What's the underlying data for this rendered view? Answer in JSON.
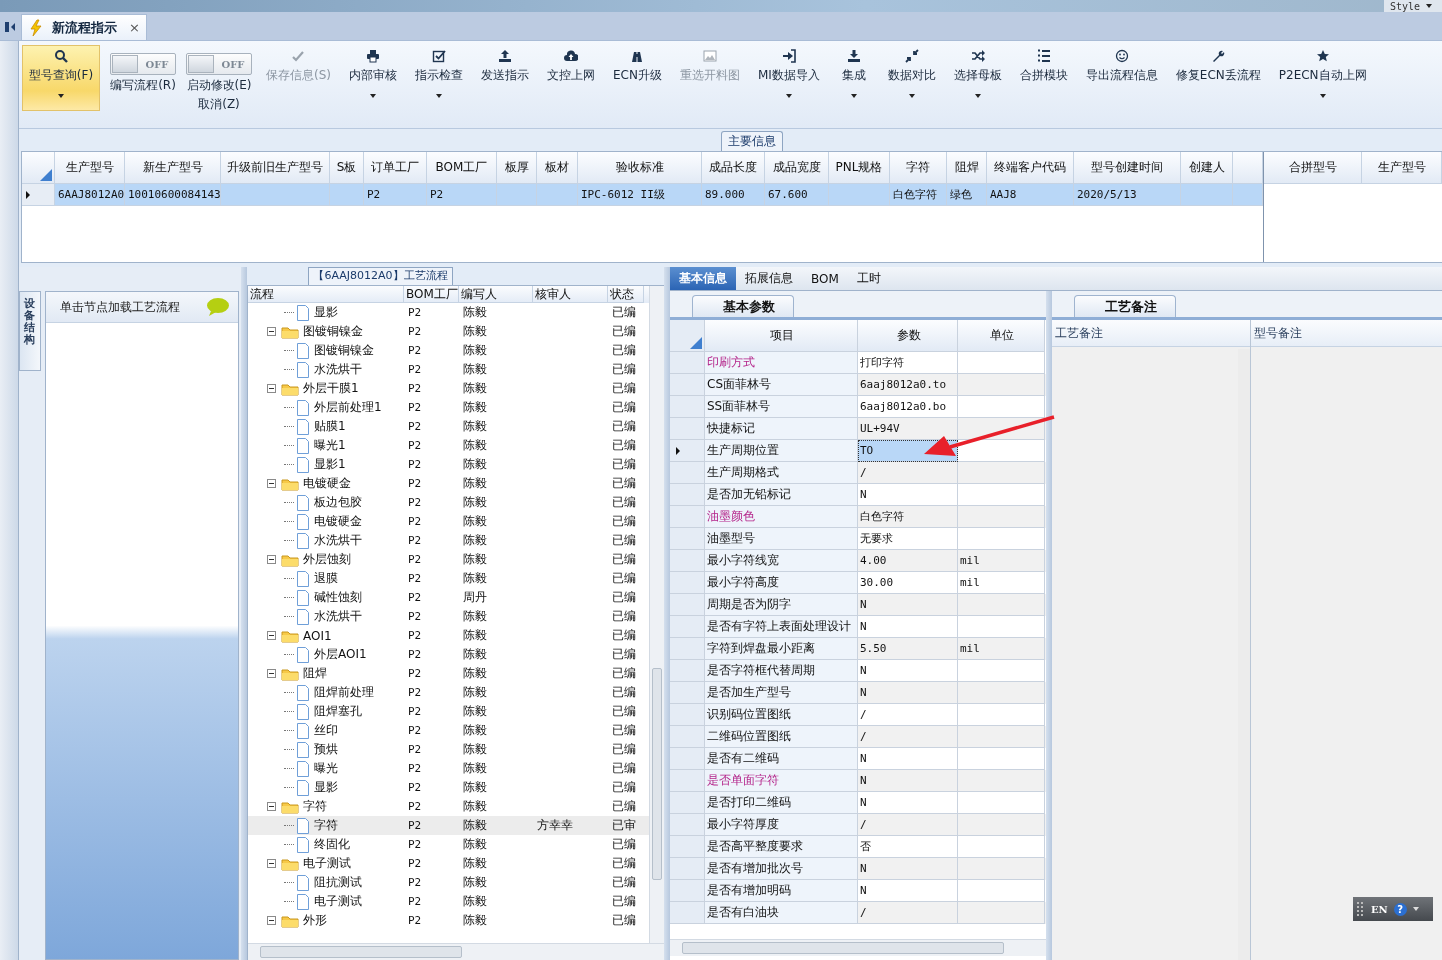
{
  "window": {
    "style_menu": "Style"
  },
  "doc_tab": {
    "title": "新流程指示",
    "close": "×"
  },
  "ribbon": [
    {
      "kind": "button",
      "label": "型号查询(F)",
      "dropdown": true,
      "selected": true,
      "disabled": false
    },
    {
      "kind": "toggle",
      "label": "编写流程(R)",
      "state_text": "OFF",
      "on": false
    },
    {
      "kind": "toggle",
      "label": "启动修改(E)",
      "sublabel": "取消(Z)",
      "state_text": "OFF",
      "on": false
    },
    {
      "kind": "button",
      "label": "保存信息(S)",
      "dropdown": false,
      "selected": false,
      "disabled": true
    },
    {
      "kind": "button",
      "label": "内部审核",
      "dropdown": true,
      "selected": false,
      "disabled": false
    },
    {
      "kind": "button",
      "label": "指示检查",
      "dropdown": true,
      "selected": false,
      "disabled": false
    },
    {
      "kind": "button",
      "label": "发送指示",
      "dropdown": false,
      "selected": false,
      "disabled": false
    },
    {
      "kind": "button",
      "label": "文控上网",
      "dropdown": false,
      "selected": false,
      "disabled": false
    },
    {
      "kind": "button",
      "label": "ECN升级",
      "dropdown": false,
      "selected": false,
      "disabled": false
    },
    {
      "kind": "button",
      "label": "重选开料图",
      "dropdown": false,
      "selected": false,
      "disabled": true
    },
    {
      "kind": "button",
      "label": "MI数据导入",
      "dropdown": true,
      "selected": false,
      "disabled": false
    },
    {
      "kind": "button",
      "label": "集成",
      "dropdown": true,
      "selected": false,
      "disabled": false
    },
    {
      "kind": "button",
      "label": "数据对比",
      "dropdown": true,
      "selected": false,
      "disabled": false
    },
    {
      "kind": "button",
      "label": "选择母板",
      "dropdown": true,
      "selected": false,
      "disabled": false
    },
    {
      "kind": "button",
      "label": "合拼模块",
      "dropdown": false,
      "selected": false,
      "disabled": false
    },
    {
      "kind": "button",
      "label": "导出流程信息",
      "dropdown": false,
      "selected": false,
      "disabled": false
    },
    {
      "kind": "button",
      "label": "修复ECN丢流程",
      "dropdown": false,
      "selected": false,
      "disabled": false
    },
    {
      "kind": "button",
      "label": "P2ECN自动上网",
      "dropdown": true,
      "selected": false,
      "disabled": false
    }
  ],
  "main_info": {
    "title": "主要信息",
    "columns": [
      "生产型号",
      "新生产型号",
      "升级前旧生产型号",
      "S板",
      "订单工厂",
      "BOM工厂",
      "板厚",
      "板材",
      "验收标准",
      "成品长度",
      "成品宽度",
      "PNL规格",
      "字符",
      "阻焊",
      "终端客户代码",
      "型号创建时间",
      "创建人"
    ],
    "rows": [
      {
        "selected": true,
        "cells": [
          "6AAJ8012A0",
          "10010600084143",
          null,
          null,
          "P2",
          "P2",
          null,
          null,
          "IPC-6012 II级",
          "89.000",
          "67.600",
          null,
          "白色字符",
          "绿色",
          "AAJ8",
          "2020/5/13",
          null
        ]
      }
    ]
  },
  "merge_grid": {
    "columns": [
      "合拼型号",
      "生产型号"
    ]
  },
  "side_tab": "设备结构",
  "side_hint": "单击节点加载工艺流程",
  "flow": {
    "title": "【6AAJ8012A0】工艺流程",
    "columns": [
      "流程",
      "BOM工厂",
      "编写人",
      "核审人",
      "状态"
    ],
    "nodes": [
      {
        "kind": "folder",
        "expanded": true,
        "children": [
          {
            "kind": "file",
            "name": "显影",
            "bom": "P2",
            "author": "陈毅",
            "status": "已编",
            "selected": false
          }
        ]
      },
      {
        "kind": "folder",
        "name": "图镀铜镍金",
        "bom": "P2",
        "author": "陈毅",
        "status": "已编",
        "selected": false,
        "expanded": true,
        "children": [
          {
            "kind": "file",
            "name": "图镀铜镍金",
            "bom": "P2",
            "author": "陈毅",
            "status": "已编",
            "selected": false
          },
          {
            "kind": "file",
            "name": "水洗烘干",
            "bom": "P2",
            "author": "陈毅",
            "status": "已编",
            "selected": false
          }
        ]
      },
      {
        "kind": "folder",
        "name": "外层干膜1",
        "bom": "P2",
        "author": "陈毅",
        "status": "已编",
        "selected": false,
        "expanded": true,
        "children": [
          {
            "kind": "file",
            "name": "外层前处理1",
            "bom": "P2",
            "author": "陈毅",
            "status": "已编",
            "selected": false
          },
          {
            "kind": "file",
            "name": "贴膜1",
            "bom": "P2",
            "author": "陈毅",
            "status": "已编",
            "selected": false
          },
          {
            "kind": "file",
            "name": "曝光1",
            "bom": "P2",
            "author": "陈毅",
            "status": "已编",
            "selected": false
          },
          {
            "kind": "file",
            "name": "显影1",
            "bom": "P2",
            "author": "陈毅",
            "status": "已编",
            "selected": false
          }
        ]
      },
      {
        "kind": "folder",
        "name": "电镀硬金",
        "bom": "P2",
        "author": "陈毅",
        "status": "已编",
        "selected": false,
        "expanded": true,
        "children": [
          {
            "kind": "file",
            "name": "板边包胶",
            "bom": "P2",
            "author": "陈毅",
            "status": "已编",
            "selected": false
          },
          {
            "kind": "file",
            "name": "电镀硬金",
            "bom": "P2",
            "author": "陈毅",
            "status": "已编",
            "selected": false
          },
          {
            "kind": "file",
            "name": "水洗烘干",
            "bom": "P2",
            "author": "陈毅",
            "status": "已编",
            "selected": false
          }
        ]
      },
      {
        "kind": "folder",
        "name": "外层蚀刻",
        "bom": "P2",
        "author": "陈毅",
        "status": "已编",
        "selected": false,
        "expanded": true,
        "children": [
          {
            "kind": "file",
            "name": "退膜",
            "bom": "P2",
            "author": "陈毅",
            "status": "已编",
            "selected": false
          },
          {
            "kind": "file",
            "name": "碱性蚀刻",
            "bom": "P2",
            "author": "周丹",
            "status": "已编",
            "selected": false
          },
          {
            "kind": "file",
            "name": "水洗烘干",
            "bom": "P2",
            "author": "陈毅",
            "status": "已编",
            "selected": false
          }
        ]
      },
      {
        "kind": "folder",
        "name": "AOI1",
        "bom": "P2",
        "author": "陈毅",
        "status": "已编",
        "selected": false,
        "expanded": true,
        "children": [
          {
            "kind": "file",
            "name": "外层AOI1",
            "bom": "P2",
            "author": "陈毅",
            "status": "已编",
            "selected": false
          }
        ]
      },
      {
        "kind": "folder",
        "name": "阻焊",
        "bom": "P2",
        "author": "陈毅",
        "status": "已编",
        "selected": false,
        "expanded": true,
        "children": [
          {
            "kind": "file",
            "name": "阻焊前处理",
            "bom": "P2",
            "author": "陈毅",
            "status": "已编",
            "selected": false
          },
          {
            "kind": "file",
            "name": "阻焊塞孔",
            "bom": "P2",
            "author": "陈毅",
            "status": "已编",
            "selected": false
          },
          {
            "kind": "file",
            "name": "丝印",
            "bom": "P2",
            "author": "陈毅",
            "status": "已编",
            "selected": false
          },
          {
            "kind": "file",
            "name": "预烘",
            "bom": "P2",
            "author": "陈毅",
            "status": "已编",
            "selected": false
          },
          {
            "kind": "file",
            "name": "曝光",
            "bom": "P2",
            "author": "陈毅",
            "status": "已编",
            "selected": false
          },
          {
            "kind": "file",
            "name": "显影",
            "bom": "P2",
            "author": "陈毅",
            "status": "已编",
            "selected": false
          }
        ]
      },
      {
        "kind": "folder",
        "name": "字符",
        "bom": "P2",
        "author": "陈毅",
        "status": "已编",
        "selected": false,
        "expanded": true,
        "children": [
          {
            "kind": "file",
            "name": "字符",
            "bom": "P2",
            "author": "陈毅",
            "reviewer": "方幸幸",
            "status": "已审",
            "selected": true
          },
          {
            "kind": "file",
            "name": "终固化",
            "bom": "P2",
            "author": "陈毅",
            "status": "已编",
            "selected": false
          }
        ]
      },
      {
        "kind": "folder",
        "name": "电子测试",
        "bom": "P2",
        "author": "陈毅",
        "status": "已编",
        "selected": false,
        "expanded": true,
        "children": [
          {
            "kind": "file",
            "name": "阻抗测试",
            "bom": "P2",
            "author": "陈毅",
            "status": "已编",
            "selected": false
          },
          {
            "kind": "file",
            "name": "电子测试",
            "bom": "P2",
            "author": "陈毅",
            "status": "已编",
            "selected": false
          }
        ]
      },
      {
        "kind": "folder",
        "name": "外形",
        "bom": "P2",
        "author": "陈毅",
        "status": "已编",
        "selected": false,
        "expanded": true
      }
    ]
  },
  "detail_tabs": [
    {
      "label": "基本信息",
      "selected": true
    },
    {
      "label": "拓展信息",
      "selected": false
    },
    {
      "label": "BOM",
      "selected": false
    },
    {
      "label": "工时",
      "selected": false
    }
  ],
  "basic_params": {
    "tab": "基本参数",
    "columns": [
      "项目",
      "参数",
      "单位"
    ],
    "rows": [
      {
        "item": "印刷方式",
        "value": "打印字符",
        "emphasis": true,
        "selected": false
      },
      {
        "item": "CS面菲林号",
        "value": "6aaj8012a0.to",
        "emphasis": false,
        "selected": false
      },
      {
        "item": "SS面菲林号",
        "value": "6aaj8012a0.bo",
        "emphasis": false,
        "selected": false
      },
      {
        "item": "快捷标记",
        "value": "UL+94V",
        "emphasis": false,
        "selected": false
      },
      {
        "item": "生产周期位置",
        "value": "TO",
        "emphasis": false,
        "selected": true
      },
      {
        "item": "生产周期格式",
        "value": "/",
        "emphasis": false,
        "selected": false
      },
      {
        "item": "是否加无铅标记",
        "value": "N",
        "emphasis": false,
        "selected": false
      },
      {
        "item": "油墨颜色",
        "value": "白色字符",
        "emphasis": true,
        "selected": false
      },
      {
        "item": "油墨型号",
        "value": "无要求",
        "emphasis": false,
        "selected": false
      },
      {
        "item": "最小字符线宽",
        "value": "4.00",
        "unit": "mil",
        "emphasis": false,
        "selected": false
      },
      {
        "item": "最小字符高度",
        "value": "30.00",
        "unit": "mil",
        "emphasis": false,
        "selected": false
      },
      {
        "item": "周期是否为阴字",
        "value": "N",
        "emphasis": false,
        "selected": false
      },
      {
        "item": "是否有字符上表面处理设计",
        "value": "N",
        "emphasis": false,
        "selected": false
      },
      {
        "item": "字符到焊盘最小距离",
        "value": "5.50",
        "unit": "mil",
        "emphasis": false,
        "selected": false
      },
      {
        "item": "是否字符框代替周期",
        "value": "N",
        "emphasis": false,
        "selected": false
      },
      {
        "item": "是否加生产型号",
        "value": "N",
        "emphasis": false,
        "selected": false
      },
      {
        "item": "识别码位置图纸",
        "value": "/",
        "emphasis": false,
        "selected": false
      },
      {
        "item": "二维码位置图纸",
        "value": "/",
        "emphasis": false,
        "selected": false
      },
      {
        "item": "是否有二维码",
        "value": "N",
        "emphasis": false,
        "selected": false
      },
      {
        "item": "是否单面字符",
        "value": "N",
        "emphasis": true,
        "selected": false
      },
      {
        "item": "是否打印二维码",
        "value": "N",
        "emphasis": false,
        "selected": false
      },
      {
        "item": "最小字符厚度",
        "value": "/",
        "emphasis": false,
        "selected": false
      },
      {
        "item": "是否高平整度要求",
        "value": "否",
        "emphasis": false,
        "selected": false
      },
      {
        "item": "是否有增加批次号",
        "value": "N",
        "emphasis": false,
        "selected": false
      },
      {
        "item": "是否有增加明码",
        "value": "N",
        "emphasis": false,
        "selected": false
      },
      {
        "item": "是否有白油块",
        "value": "/",
        "emphasis": false,
        "selected": false
      }
    ]
  },
  "notes": {
    "tab": "工艺备注",
    "columns": [
      "工艺备注",
      "型号备注"
    ]
  },
  "ime_bar": {
    "language": "EN",
    "help": "?"
  }
}
